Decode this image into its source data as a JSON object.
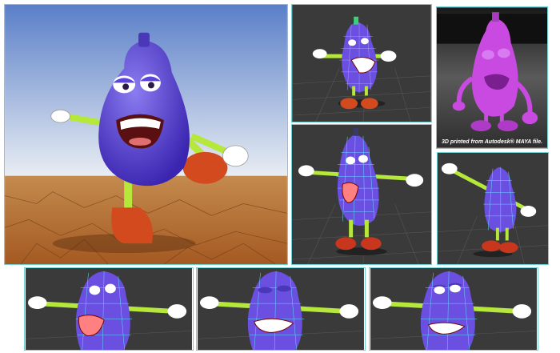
{
  "panels": {
    "hero_render": {
      "label": ""
    },
    "printed_photo": {
      "caption": "3D printed from Autodesk® MAYA file."
    }
  },
  "colors": {
    "frame_border": "#6fd1d4",
    "character_body": "#5a45d8",
    "wireframe_body": "#6a4fe0",
    "limbs": "#b5e83a",
    "shoes": "#d24a1e",
    "print_material": "#c94ae0",
    "sky_top": "#5a7fc8",
    "desert": "#b0672a"
  },
  "icons": [
    "eggplant-character",
    "wireframe-mesh",
    "3d-print"
  ]
}
